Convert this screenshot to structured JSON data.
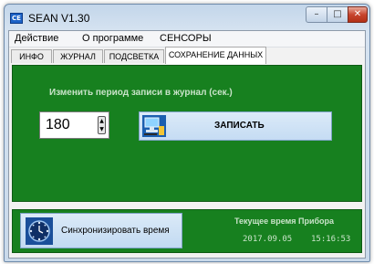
{
  "window": {
    "title": "SEAN V1.30",
    "app_icon_text": "CE",
    "minimize_symbol": "–",
    "maximize_symbol": "□",
    "close_symbol": "✕"
  },
  "menu": {
    "items": [
      "Действие",
      "О программе",
      "СЕНСОРЫ"
    ]
  },
  "tabs": {
    "items": [
      "ИНФО",
      "ЖУРНАЛ",
      "ПОДСВЕТКА",
      "СОХРАНЕНИЕ ДАННЫХ"
    ],
    "active": "СОХРАНЕНИЕ ДАННЫХ"
  },
  "record_period": {
    "label": "Изменить период записи в журнал (сек.)",
    "value": "180",
    "up_symbol": "▲",
    "down_symbol": "▼"
  },
  "write_button": {
    "label": "ЗАПИСАТЬ",
    "icon": "computer-write-icon"
  },
  "sync": {
    "button_label": "Синхронизировать время",
    "icon": "clock-icon",
    "current_time_label": "Текущее время Прибора",
    "date": "2017.09.05",
    "time": "15:16:53"
  },
  "colors": {
    "panel_green": "#17801f",
    "panel_text": "#c9e3c9",
    "button_blue": "#c5dcf3",
    "close_red": "#c7452e"
  }
}
